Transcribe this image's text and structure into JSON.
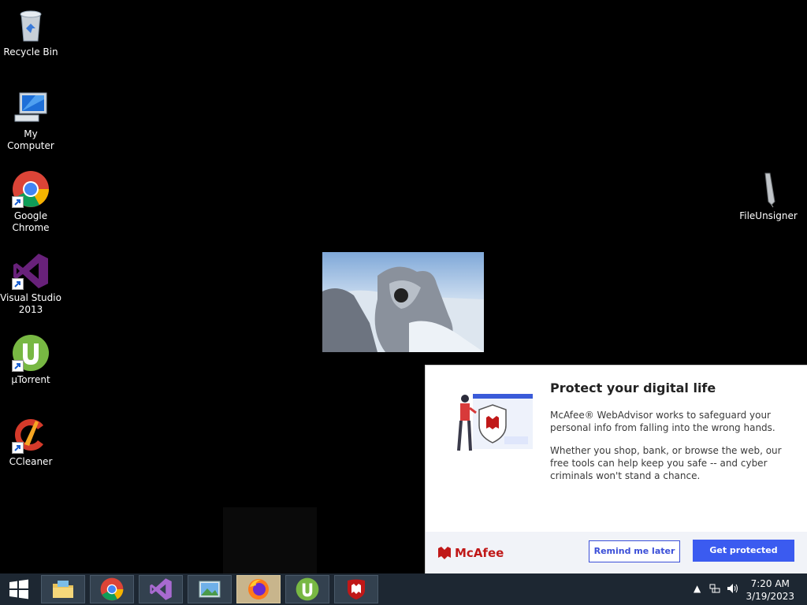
{
  "desktop": {
    "icons": [
      {
        "label": "Recycle Bin",
        "icon": "recycle-bin-icon"
      },
      {
        "label": "My Computer",
        "icon": "computer-icon"
      },
      {
        "label": "Google Chrome",
        "icon": "chrome-icon"
      },
      {
        "label": "Visual Studio 2013",
        "icon": "visual-studio-icon"
      },
      {
        "label": "µTorrent",
        "icon": "utorrent-icon"
      },
      {
        "label": "CCleaner",
        "icon": "ccleaner-icon"
      },
      {
        "label": "FileUnsigner",
        "icon": "pen-icon"
      }
    ]
  },
  "popup": {
    "title": "Protect your digital life",
    "paragraph1": "McAfee® WebAdvisor works to safeguard your personal info from falling into the wrong hands.",
    "paragraph2": "Whether you shop, bank, or browse the web, our free tools can help keep you safe -- and cyber criminals won't stand a chance.",
    "brand": "McAfee",
    "remind_label": "Remind me later",
    "protect_label": "Get protected",
    "colors": {
      "brand": "#c01818",
      "button": "#3b5bf0"
    }
  },
  "taskbar": {
    "apps": [
      {
        "name": "File Explorer",
        "icon": "folder-icon"
      },
      {
        "name": "Google Chrome",
        "icon": "chrome-icon"
      },
      {
        "name": "Visual Studio",
        "icon": "visual-studio-icon"
      },
      {
        "name": "Photo Viewer",
        "icon": "photo-icon"
      },
      {
        "name": "Firefox",
        "icon": "firefox-icon",
        "active": true
      },
      {
        "name": "µTorrent",
        "icon": "utorrent-icon"
      },
      {
        "name": "McAfee",
        "icon": "mcafee-icon"
      }
    ],
    "time": "7:20 AM",
    "date": "3/19/2023"
  }
}
